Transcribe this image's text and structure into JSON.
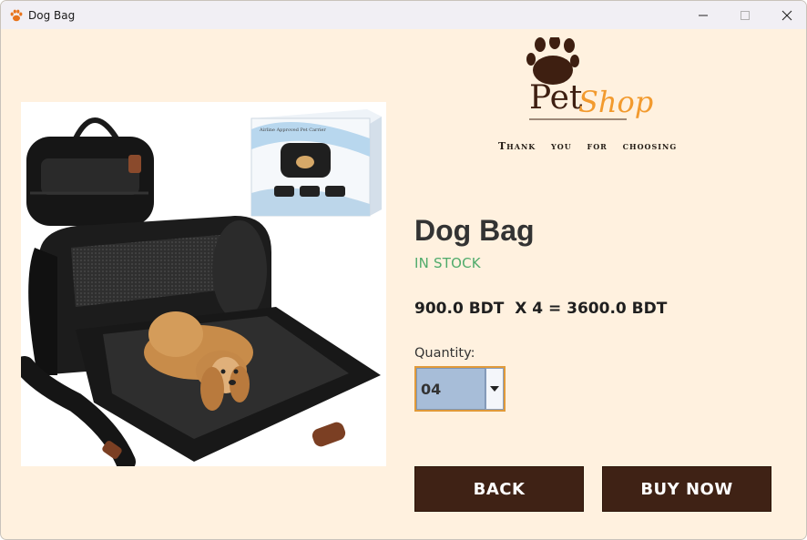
{
  "window": {
    "title": "Dog Bag",
    "controls": {
      "minimize": "—",
      "maximize": "☐",
      "close": "✕"
    }
  },
  "logo": {
    "text_pet": "Pet",
    "text_shop": "Shop"
  },
  "header": {
    "thank_you": "Thank you for choosing"
  },
  "product": {
    "name": "Dog Bag",
    "stock_status": "IN STOCK",
    "price_line": "900.0 BDT  X 4 = 3600.0 BDT",
    "image_box_text": "Airline Approved Pet Carrier"
  },
  "quantity": {
    "label": "Quantity:",
    "value": "04"
  },
  "buttons": {
    "back": "BACK",
    "buy_now": "BUY NOW"
  },
  "colors": {
    "window_bg": "#fff1df",
    "button_bg": "#3f2215",
    "stock_green": "#4fab6b",
    "select_bg": "#a7bdd8",
    "select_border": "#e09a3a",
    "logo_brown": "#3e1f11",
    "logo_orange": "#f29a2e"
  }
}
